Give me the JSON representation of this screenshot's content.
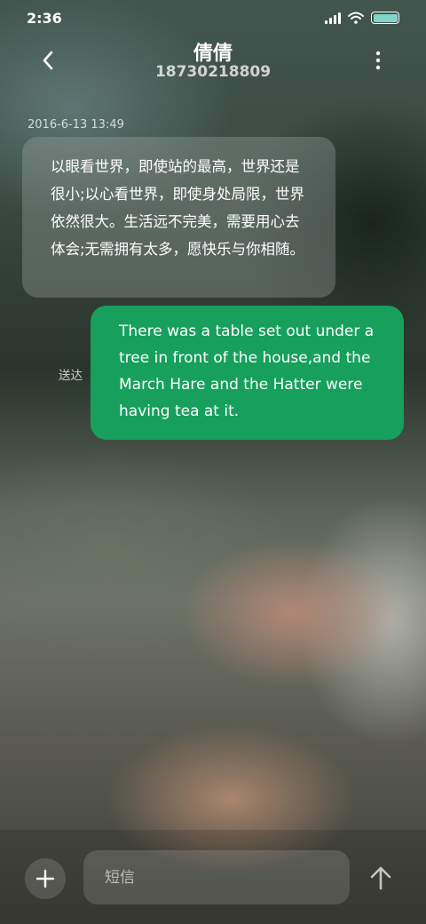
{
  "status_bar": {
    "time": "2:36",
    "icons": [
      "signal-icon",
      "wifi-icon",
      "battery-icon"
    ],
    "battery_color": "#7fd6c6"
  },
  "header": {
    "contact_name": "倩倩",
    "contact_number": "18730218809",
    "back_icon": "chevron-left-icon",
    "more_icon": "more-vertical-icon"
  },
  "conversation": {
    "timestamp": "2016-6-13 13:49",
    "incoming_message": "以眼看世界，即使站的最高，世界还是很小;以心看世界，即使身处局限，世界依然很大。生活远不完美，需要用心去体会;无需拥有太多，愿快乐与你相随。",
    "outgoing_message": "There was a table set out under a tree in front of the house,and the March Hare and the Hatter were having tea at it.",
    "outgoing_status": "送达",
    "outgoing_bubble_color": "#16a05c"
  },
  "composer": {
    "add_icon": "plus-icon",
    "input_placeholder": "短信",
    "input_value": "",
    "send_icon": "arrow-up-icon"
  }
}
